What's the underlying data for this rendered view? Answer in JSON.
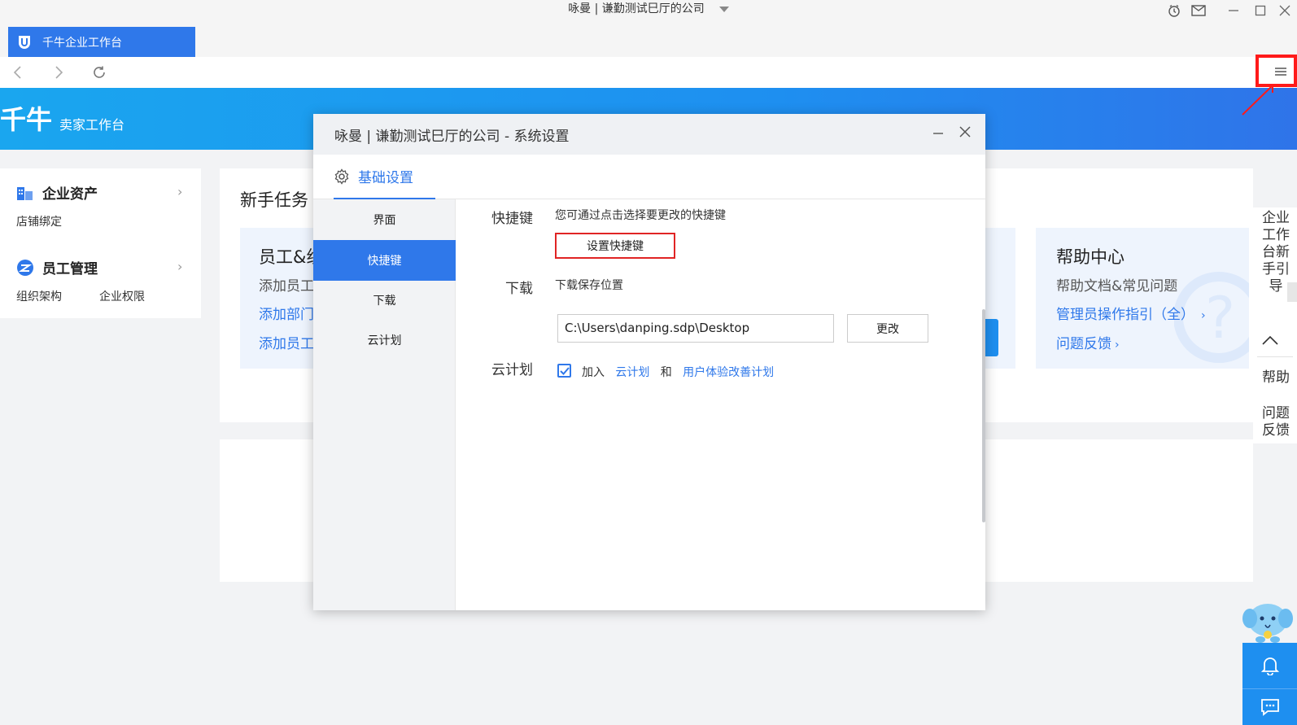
{
  "window": {
    "title": "咏曼 | 谦勤测试巳厅的公司",
    "app_tab": "千牛企业工作台"
  },
  "banner": {
    "brand": "千牛",
    "subtitle": "卖家工作台"
  },
  "left_panel": {
    "section1": {
      "title": "企业资产",
      "items": [
        "店铺绑定"
      ]
    },
    "section2": {
      "title": "员工管理",
      "items": [
        "组织架构",
        "企业权限"
      ]
    }
  },
  "main": {
    "newbie_title": "新手任务",
    "employee_card": {
      "title": "员工&组",
      "sub": "添加员工",
      "link1": "添加部门",
      "link2": "添加员工"
    },
    "help_card": {
      "title": "帮助中心",
      "sub": "帮助文档&常见问题",
      "link1": "管理员操作指引（全）",
      "link2": "问题反馈"
    }
  },
  "right_sidebar": {
    "guide": "企业工作台新手引导",
    "help": "帮助",
    "feedback": "问题反馈"
  },
  "dialog": {
    "title": "咏曼 | 谦勤测试巳厅的公司 - 系统设置",
    "tab_basic": "基础设置",
    "side_items": [
      "界面",
      "快捷键",
      "下载",
      "云计划"
    ],
    "active_side": 1,
    "shortcut": {
      "label": "快捷键",
      "desc": "您可通过点击选择要更改的快捷键",
      "button": "设置快捷键"
    },
    "download": {
      "label": "下载",
      "desc": "下载保存位置",
      "path": "C:\\Users\\danping.sdp\\Desktop",
      "change": "更改"
    },
    "cloud": {
      "label": "云计划",
      "join": "加入",
      "link1": "云计划",
      "and": "和",
      "link2": "用户体验改善计划",
      "checked": true
    }
  },
  "colors": {
    "accent": "#2f78ea",
    "banner": "#1e8ff0",
    "highlight": "#ff1a1a"
  }
}
